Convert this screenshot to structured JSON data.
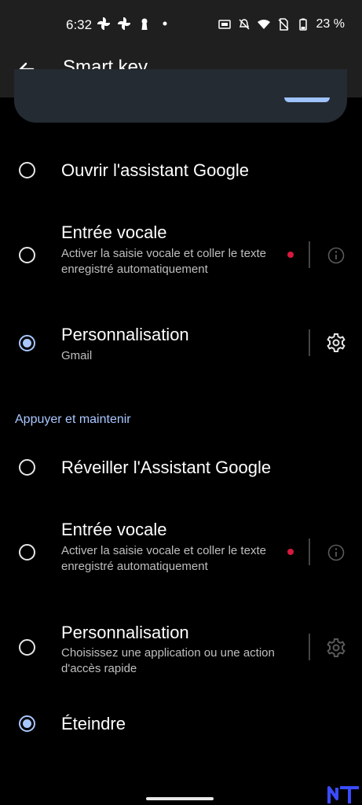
{
  "status_bar": {
    "time": "6:32",
    "battery": "23 %"
  },
  "app_bar": {
    "title": "Smart key"
  },
  "items_press": [
    {
      "title": "Ouvrir l'assistant Google",
      "selected": false
    },
    {
      "title": "Entrée vocale",
      "subtitle": "Activer la saisie vocale et coller le texte enregistré automatiquement",
      "selected": false
    },
    {
      "title": "Personnalisation",
      "subtitle": "Gmail",
      "selected": true
    }
  ],
  "section_hold": {
    "label": "Appuyer et maintenir"
  },
  "items_hold": [
    {
      "title": "Réveiller l'Assistant Google",
      "selected": false
    },
    {
      "title": "Entrée vocale",
      "subtitle": "Activer la saisie vocale et coller le texte enregistré automatiquement",
      "selected": false
    },
    {
      "title": "Personnalisation",
      "subtitle": "Choisissez une application ou une action d'accès rapide",
      "selected": false
    },
    {
      "title": "Éteindre",
      "selected": true
    }
  ],
  "colors": {
    "accent": "#a9c7ff",
    "recording_dot": "#d7193d",
    "background": "#000000"
  }
}
